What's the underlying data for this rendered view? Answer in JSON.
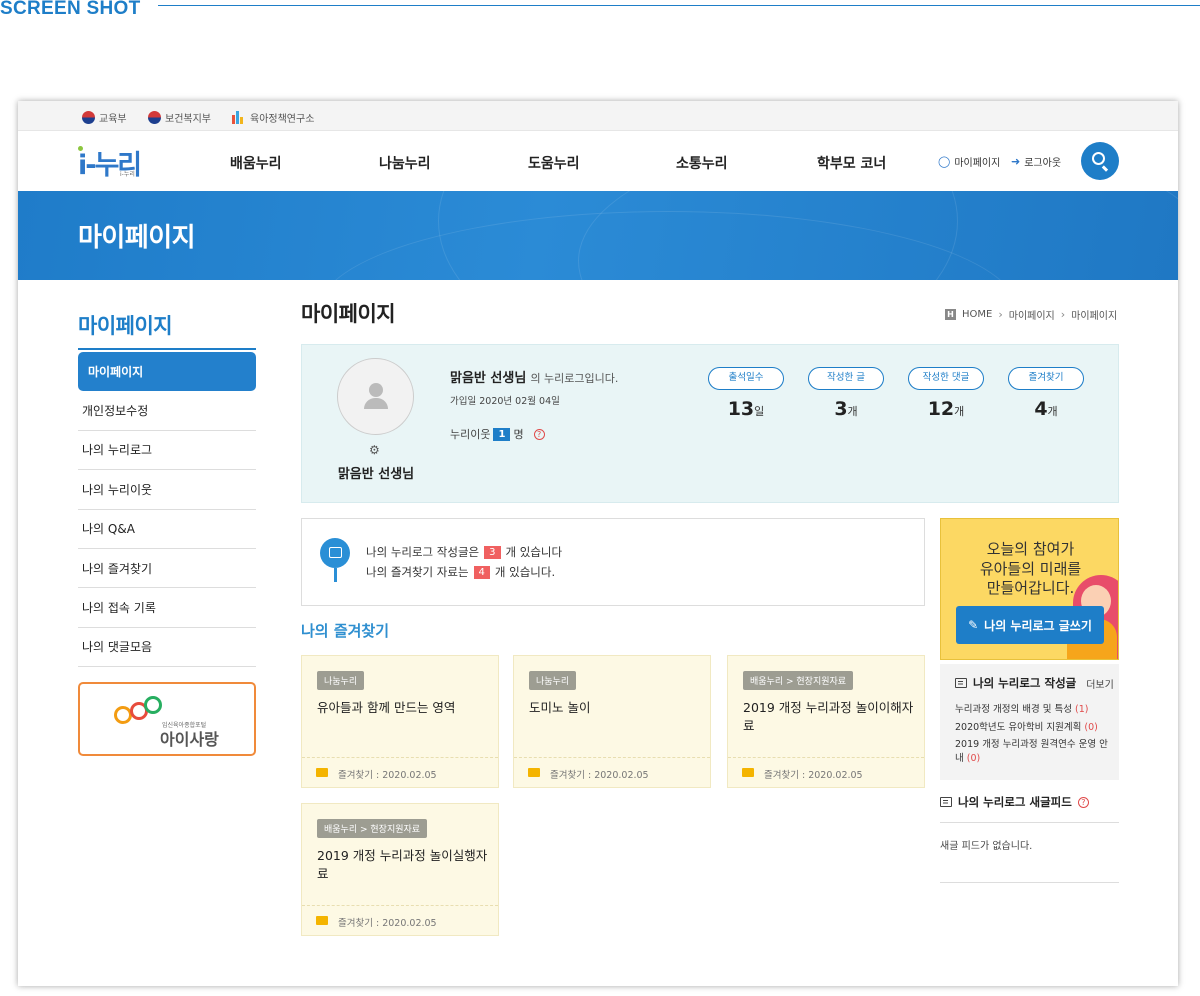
{
  "screenshot_label": "SCREEN SHOT",
  "topbar": {
    "orgs": [
      {
        "label": "교육부",
        "icon": "gov-emblem-icon"
      },
      {
        "label": "보건복지부",
        "icon": "gov-emblem-icon"
      },
      {
        "label": "육아정책연구소",
        "icon": "kicce-logo-icon"
      }
    ]
  },
  "nav": {
    "logo_main": "i-누리",
    "logo_sub": "i-누리",
    "menu": [
      "배움누리",
      "나눔누리",
      "도움누리",
      "소통누리",
      "학부모 코너"
    ],
    "mypage_label": "마이페이지",
    "logout_label": "로그아웃",
    "accent": "#1e7ec8"
  },
  "banner": {
    "title": "마이페이지"
  },
  "sidebar": {
    "title": "마이페이지",
    "items": [
      {
        "label": "마이페이지",
        "active": true
      },
      {
        "label": "개인정보수정"
      },
      {
        "label": "나의 누리로그"
      },
      {
        "label": "나의 누리이웃"
      },
      {
        "label": "나의 Q&A"
      },
      {
        "label": "나의 즐겨찾기"
      },
      {
        "label": "나의 접속 기록"
      },
      {
        "label": "나의 댓글모음"
      }
    ],
    "banner_sub": "임신육아종합포털",
    "banner_title": "아이사랑"
  },
  "main": {
    "title": "마이페이지",
    "breadcrumb": [
      "HOME",
      "마이페이지",
      "마이페이지"
    ],
    "profile": {
      "name": "맑음반 선생님",
      "greet_suffix": "의 누리로그입니다.",
      "join_date": "가입일 2020년 02월 04일",
      "neighbor_label": "누리이웃",
      "neighbor_count": "1",
      "neighbor_unit": "명",
      "stats": [
        {
          "label": "출석일수",
          "value": "13",
          "unit": "일"
        },
        {
          "label": "작성한 글",
          "value": "3",
          "unit": "개"
        },
        {
          "label": "작성한 댓글",
          "value": "12",
          "unit": "개"
        },
        {
          "label": "즐겨찾기",
          "value": "4",
          "unit": "개"
        }
      ]
    },
    "notice": {
      "line1_pre": "나의 누리로그 작성글은",
      "line1_count": "3",
      "line1_post": "개 있습니다",
      "line2_pre": "나의 즐겨찾기 자료는",
      "line2_count": "4",
      "line2_post": "개 있습니다."
    },
    "favorites_title": "나의 즐겨찾기",
    "favorites": [
      {
        "tag": "나눔누리",
        "title": "유아들과 함께 만드는 영역",
        "date": "즐겨찾기 : 2020.02.05"
      },
      {
        "tag": "나눔누리",
        "title": "도미노 놀이",
        "date": "즐겨찾기 : 2020.02.05"
      },
      {
        "tag": "배움누리 > 현장지원자료",
        "title": "2019 개정 누리과정 놀이이해자료",
        "date": "즐겨찾기 : 2020.02.05"
      },
      {
        "tag": "배움누리 > 현장지원자료",
        "title": "2019 개정 누리과정 놀이실행자료",
        "date": "즐겨찾기 : 2020.02.05"
      }
    ]
  },
  "right": {
    "promo_text": [
      "오늘의 참여가",
      "유아들의 미래를",
      "만들어갑니다."
    ],
    "promo_button": "나의 누리로그 글쓰기",
    "writes_title": "나의 누리로그 작성글",
    "writes_more": "더보기",
    "writes": [
      {
        "title": "누리과정 개정의 배경 및 특성",
        "count": "(1)"
      },
      {
        "title": "2020학년도 유아학비 지원계획",
        "count": "(0)"
      },
      {
        "title": "2019 개정 누리과정 원격연수 운영 안내",
        "count": "(0)"
      }
    ],
    "feed_title": "나의 누리로그 새글피드",
    "feed_empty": "새글 피드가 없습니다."
  }
}
